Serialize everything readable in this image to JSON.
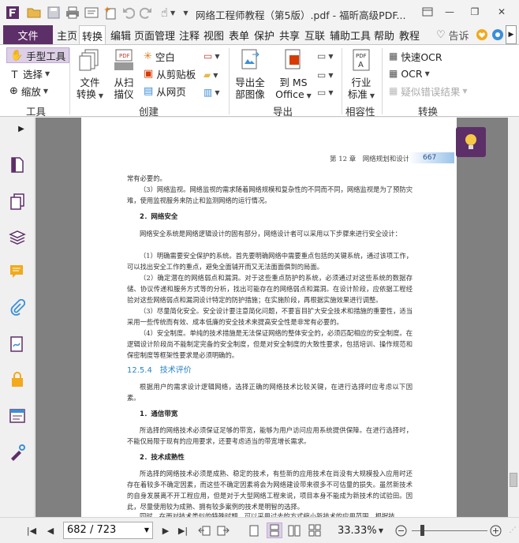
{
  "window": {
    "title": "网络工程师教程（第5版）.pdf - 福昕高级PDF...",
    "minimize": "—",
    "restore": "❐",
    "close": "✕"
  },
  "tabs": {
    "file": "文件",
    "items": [
      "主页",
      "转换",
      "编辑",
      "页面管理",
      "注释",
      "视图",
      "表单",
      "保护",
      "共享",
      "互联",
      "辅助工具",
      "帮助",
      "教程"
    ],
    "active": "转换",
    "tell_me": "告诉"
  },
  "ribbon": {
    "tools": {
      "hand": "手型工具",
      "select": "选择",
      "zoom": "缩放",
      "group": "工具"
    },
    "create": {
      "from_file_1": "文件",
      "from_file_2": "转换",
      "from_scan_1": "从扫",
      "from_scan_2": "描仪",
      "blank": "空白",
      "clipboard": "从剪贴板",
      "webpage": "从网页",
      "group": "创建"
    },
    "export": {
      "all_images_1": "导出全",
      "all_images_2": "部图像",
      "to_ms_1": "到 MS",
      "to_ms_2": "Office",
      "group": "导出"
    },
    "compat": {
      "industry_1": "行业",
      "industry_2": "标准",
      "group": "相容性"
    },
    "convert": {
      "quick_ocr": "快速OCR",
      "ocr": "OCR",
      "suspect": "疑似错误结果",
      "group": "转换"
    }
  },
  "document": {
    "running_head": "第 12 章　网络规划和设计",
    "page_number": "667",
    "paragraphs": [
      "常有必要的。",
      "（3）网络监视。网络监视的需求随着网络规模和复杂性的不同而不同，网络监视是为了预防灾难，使用监视服务来防止和监测网络的运行情况。",
      "网络安全系统是网络逻辑设计的固有部分，网络设计者可以采用以下步骤来进行安全设计：",
      "（1）明确需要安全保护的系统。首先要明确网络中需要重点包括的关键系统，通过该项工作，可以找出安全工作的重点，避免全面铺开而又无法面面俱到的局面。",
      "（2）确定潜在的网络弱点和漏洞。对于这些重点防护的系统，必须通过对这些系统的数据存储、协议传递和服务方式等的分析，找出可能存在的网络弱点和漏洞。在设计阶段，应依据工程经验对这些网络弱点和漏洞设计特定的防护措施；在实施阶段，再根据实施效果进行调整。",
      "（3）尽量简化安全。安全设计要注意简化问题，不要盲目扩大安全技术和措施的重要性，适当采用一些传统而有效、成本低廉的安全技术来提高安全性是非常有必要的。",
      "（4）安全制度。单纯的技术措施是无法保证网络的整体安全的，必须匹配相应的安全制度。在逻辑设计阶段尚不能制定完备的安全制度，但是对安全制度的大致性要求，包括培训、操作规范和保密制度等框架性要求是必须明确的。",
      "根据用户的需求设计逻辑网络，选择正确的网络技术比较关键，在进行选择时应考虑以下因素。",
      "所选择的网络技术必须保证足够的带宽，能够为用户访问应用系统提供保障。在进行选择时，不能仅局限于现有的应用要求，还要考虑适当的带宽增长需求。",
      "所选择的网络技术必须是成熟、稳定的技术，有些新的应用技术在尚没有大规模投入应用时还存在着较多不确定因素，而这些不确定因素将会为网络建设带来很多不可估量的损失。虽然新技术的自身发展离不开工程应用，但是对于大型网络工程来说，项目本身不能成为新技术的试验田。因此，尽量使用较为成熟、拥有较多案例的技术是明智的选择。",
      "同时，在面对技术类似的特殊时期，可以采用过去的方式缩小新技术的应用范围。根据技"
    ],
    "heading_security": "2．网络安全",
    "section": "12.5.4　技术评价",
    "heading_bandwidth": "1．通信带宽",
    "heading_maturity": "2．技术成熟性"
  },
  "statusbar": {
    "page": "682 / 723",
    "zoom": "33.33%"
  },
  "colors": {
    "brand": "#5d2f68",
    "heading_blue": "#2683c6",
    "selected_tool": "#dccfe6"
  }
}
